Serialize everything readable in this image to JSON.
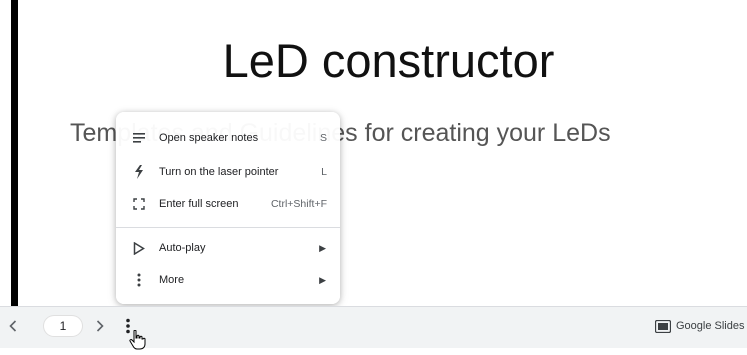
{
  "slide": {
    "title": "LeD constructor",
    "subtitle": "Templates and Guidelines for creating your LeDs"
  },
  "context_menu": {
    "items": [
      {
        "label": "Open speaker notes",
        "shortcut": "S",
        "icon": "notes-icon"
      },
      {
        "label": "Turn on the laser pointer",
        "shortcut": "L",
        "icon": "laser-pointer-icon"
      },
      {
        "label": "Enter full screen",
        "shortcut": "Ctrl+Shift+F",
        "icon": "fullscreen-icon"
      },
      {
        "label": "Auto-play",
        "icon": "play-icon",
        "submenu": true
      },
      {
        "label": "More",
        "icon": "more-vert-icon",
        "submenu": true
      }
    ]
  },
  "toolbar": {
    "prev_icon": "chevron-left-icon",
    "page_number": "1",
    "next_icon": "chevron-right-icon",
    "more_icon": "more-vert-icon",
    "brand_label": "Google Slides",
    "brand_icon": "google-slides-icon"
  },
  "colors": {
    "toolbar_bg": "#f1f3f4",
    "menu_bg": "#ffffff",
    "slide_bar": "#000000"
  }
}
